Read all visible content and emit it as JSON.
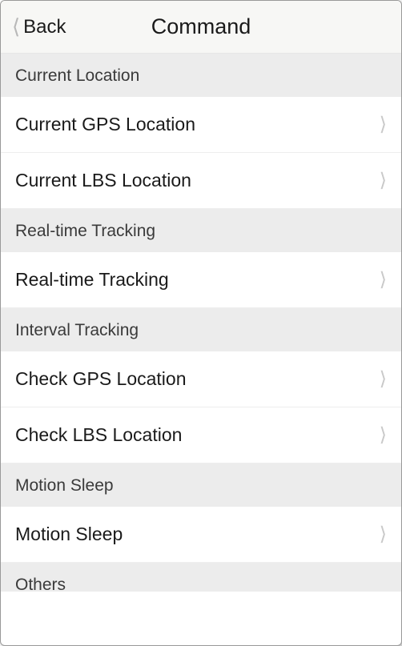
{
  "header": {
    "back_label": "Back",
    "title": "Command"
  },
  "sections": [
    {
      "title": "Current Location",
      "items": [
        {
          "label": "Current GPS Location"
        },
        {
          "label": "Current LBS Location"
        }
      ]
    },
    {
      "title": "Real-time Tracking",
      "items": [
        {
          "label": "Real-time Tracking"
        }
      ]
    },
    {
      "title": "Interval Tracking",
      "items": [
        {
          "label": "Check GPS Location"
        },
        {
          "label": "Check LBS Location"
        }
      ]
    },
    {
      "title": "Motion Sleep",
      "items": [
        {
          "label": "Motion Sleep"
        }
      ]
    },
    {
      "title": "Others",
      "items": []
    }
  ]
}
